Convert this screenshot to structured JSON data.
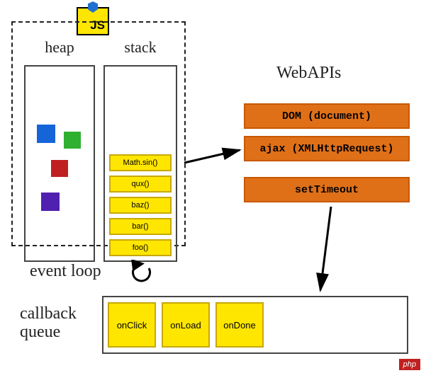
{
  "js_badge": {
    "text": "JS"
  },
  "runtime": {
    "heap_label": "heap",
    "stack_label": "stack",
    "stack_frames": [
      "Math.sin()",
      "qux()",
      "baz()",
      "bar()",
      "foo()"
    ]
  },
  "webapis": {
    "title": "WebAPIs",
    "items": [
      "DOM (document)",
      "ajax (XMLHttpRequest)",
      "setTimeout"
    ]
  },
  "event_loop_label": "event loop",
  "callback": {
    "label": "callback\nqueue",
    "items": [
      "onClick",
      "onLoad",
      "onDone"
    ]
  },
  "watermark": "php"
}
